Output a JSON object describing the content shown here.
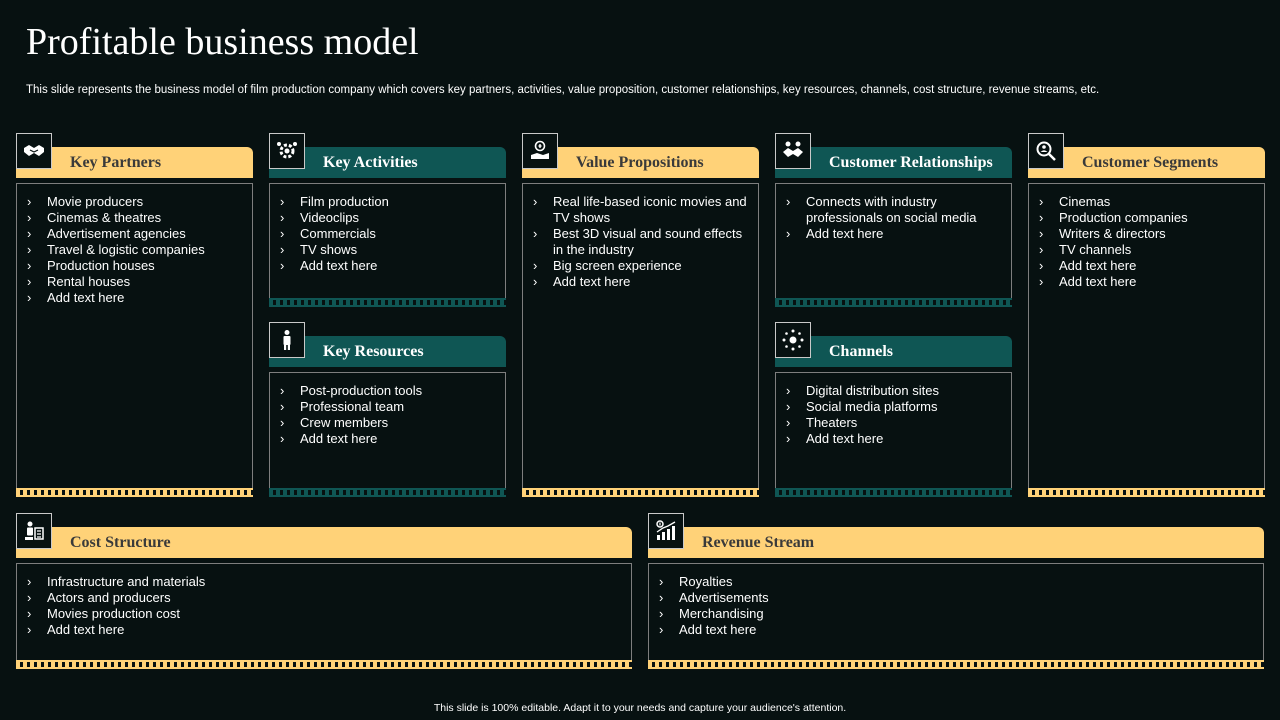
{
  "slide": {
    "title": "Profitable business model",
    "subtitle": "This slide represents the business model of film production company which covers key partners, activities, value proposition, customer relationships, key resources, channels, cost structure, revenue streams, etc.",
    "footer": "This slide is 100% editable. Adapt it to your needs and capture your audience's attention."
  },
  "colors": {
    "background": "#071111",
    "yellow": "#ffd278",
    "teal": "#0f5654"
  },
  "blocks": {
    "key_partners": {
      "title": "Key Partners",
      "icon": "handshake-icon",
      "items": [
        "Movie producers",
        "Cinemas & theatres",
        "Advertisement agencies",
        "Travel  & logistic companies",
        "Production houses",
        "Rental houses",
        "Add text here"
      ]
    },
    "key_activities": {
      "title": "Key Activities",
      "icon": "gear-people-icon",
      "items": [
        "Film production",
        "Videoclips",
        "Commercials",
        "TV shows",
        "Add text here"
      ]
    },
    "key_resources": {
      "title": "Key Resources",
      "icon": "person-icon",
      "items": [
        "Post-production tools",
        "Professional team",
        "Crew members",
        "Add text here"
      ]
    },
    "value_propositions": {
      "title": "Value Propositions",
      "icon": "value-hand-icon",
      "items": [
        "Real life-based iconic movies and TV shows",
        "Best 3D visual and sound effects in the industry",
        "Big screen experience",
        "Add text here"
      ]
    },
    "customer_relationships": {
      "title": "Customer Relationships",
      "icon": "handshake-people-icon",
      "items": [
        "Connects with industry professionals on social media",
        "Add text here"
      ]
    },
    "channels": {
      "title": "Channels",
      "icon": "network-icon",
      "items": [
        "Digital distribution sites",
        "Social media platforms",
        "Theaters",
        "Add text here"
      ]
    },
    "customer_segments": {
      "title": "Customer Segments",
      "icon": "magnifier-people-icon",
      "items": [
        "Cinemas",
        "Production companies",
        "Writers & directors",
        "TV channels",
        "Add text here",
        "Add text here"
      ]
    },
    "cost_structure": {
      "title": "Cost Structure",
      "icon": "cost-icon",
      "items": [
        "Infrastructure  and materials",
        "Actors and producers",
        "Movies  production cost",
        "Add text here"
      ]
    },
    "revenue_stream": {
      "title": "Revenue Stream",
      "icon": "revenue-chart-icon",
      "items": [
        "Royalties",
        "Advertisements",
        "Merchandising",
        "Add text here"
      ]
    }
  }
}
